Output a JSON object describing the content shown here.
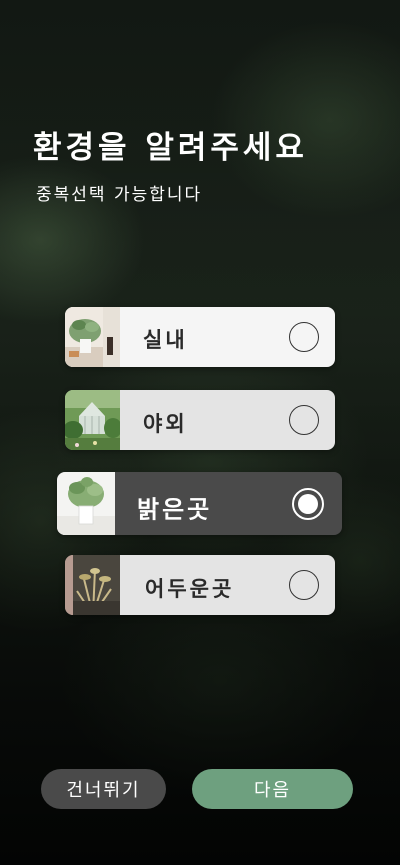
{
  "header": {
    "title": "환경을 알려주세요",
    "subtitle": "중복선택 가능합니다"
  },
  "options": [
    {
      "label": "실내",
      "selected": false,
      "thumbnail_icon": "indoor-plant-photo"
    },
    {
      "label": "야외",
      "selected": false,
      "thumbnail_icon": "greenhouse-photo"
    },
    {
      "label": "밝은곳",
      "selected": true,
      "thumbnail_icon": "potted-plant-bright-photo"
    },
    {
      "label": "어두운곳",
      "selected": false,
      "thumbnail_icon": "plant-shadow-photo"
    }
  ],
  "footer": {
    "skip_label": "건너뛰기",
    "next_label": "다음"
  },
  "colors": {
    "background": "#0b100c",
    "selected_card": "#4a4a4a",
    "card": "#e4e4e4",
    "skip_button": "#4a4a4a",
    "next_button": "#6ea07f",
    "text_primary": "#ffffff"
  }
}
